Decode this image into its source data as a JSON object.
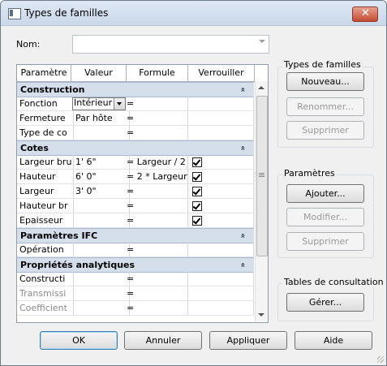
{
  "window": {
    "title": "Types de familles",
    "close_glyph": "✕"
  },
  "nom": {
    "label": "Nom:",
    "value": ""
  },
  "grid": {
    "headers": [
      "Paramètre",
      "Valeur",
      "Formule",
      "Verrouiller"
    ],
    "sections": [
      {
        "name": "Construction",
        "chevron": "«",
        "rows": [
          {
            "param": "Fonction",
            "value": "Intérieur",
            "formula": "=",
            "locked": false
          },
          {
            "param": "Fermeture",
            "value": "Par hôte",
            "formula": "=",
            "locked": false
          },
          {
            "param": "Type de co",
            "value": "",
            "formula": "=",
            "locked": false
          }
        ]
      },
      {
        "name": "Cotes",
        "chevron": "«",
        "rows": [
          {
            "param": "Largeur bru",
            "value": "1'  6\"",
            "formula": "= Largeur / 2",
            "locked": true
          },
          {
            "param": "Hauteur",
            "value": "6'  0\"",
            "formula": "= 2 * Largeur",
            "locked": true
          },
          {
            "param": "Largeur",
            "value": "3'  0\"",
            "formula": "=",
            "locked": true
          },
          {
            "param": "Hauteur br",
            "value": "",
            "formula": "=",
            "locked": true
          },
          {
            "param": "Epaisseur",
            "value": "",
            "formula": "=",
            "locked": true
          }
        ]
      },
      {
        "name": "Paramètres IFC",
        "chevron": "«",
        "rows": [
          {
            "param": "Opération",
            "value": "",
            "formula": "=",
            "locked": false
          }
        ]
      },
      {
        "name": "Propriétés analytiques",
        "chevron": "«",
        "rows": [
          {
            "param": "Constructi",
            "value": "",
            "formula": "=",
            "locked": false
          },
          {
            "param": "Transmissi",
            "value": "",
            "formula": "=",
            "locked": false
          },
          {
            "param": "Coefficient",
            "value": "",
            "formula": "=",
            "locked": false
          }
        ]
      }
    ]
  },
  "types_group": {
    "label": "Types de familles",
    "new": "Nouveau...",
    "rename": "Renommer...",
    "delete": "Supprimer"
  },
  "params_group": {
    "label": "Paramètres",
    "add": "Ajouter...",
    "modify": "Modifier...",
    "delete": "Supprimer"
  },
  "lookup_group": {
    "label": "Tables de consultation",
    "manage": "Gérer..."
  },
  "footer": {
    "ok": "OK",
    "cancel": "Annuler",
    "apply": "Appliquer",
    "help": "Aide"
  },
  "colors": {
    "section_bg": "#d5dfec",
    "title_bg": "#dfe8f4",
    "default_button_border": "#3c7fb1"
  }
}
